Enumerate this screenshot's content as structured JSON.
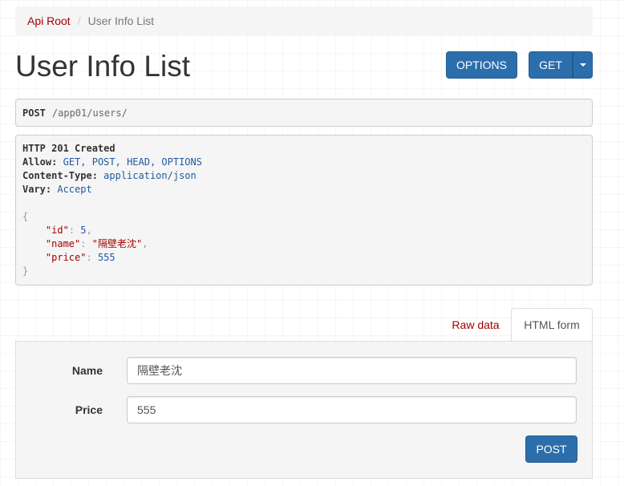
{
  "breadcrumb": {
    "root": "Api Root",
    "separator": "/",
    "current": "User Info List"
  },
  "page": {
    "title": "User Info List"
  },
  "actions": {
    "options_label": "OPTIONS",
    "get_label": "GET"
  },
  "request": {
    "method": "POST",
    "path": "/app01/users/"
  },
  "response": {
    "status": "HTTP 201 Created",
    "headers": [
      {
        "key": "Allow:",
        "value": "GET, POST, HEAD, OPTIONS"
      },
      {
        "key": "Content-Type:",
        "value": "application/json"
      },
      {
        "key": "Vary:",
        "value": "Accept"
      }
    ],
    "body": {
      "open": "{",
      "close": "}",
      "id_key": "\"id\"",
      "id_value": "5",
      "name_key": "\"name\"",
      "name_value": "\"隔壁老沈\"",
      "price_key": "\"price\"",
      "price_value": "555"
    }
  },
  "tabs": {
    "raw": "Raw data",
    "html": "HTML form"
  },
  "form": {
    "name_label": "Name",
    "name_value": "隔壁老沈",
    "price_label": "Price",
    "price_value": "555",
    "submit_label": "POST"
  },
  "colors": {
    "primary": "#2c6eab",
    "link": "#a30000",
    "well": "#f5f5f5"
  }
}
